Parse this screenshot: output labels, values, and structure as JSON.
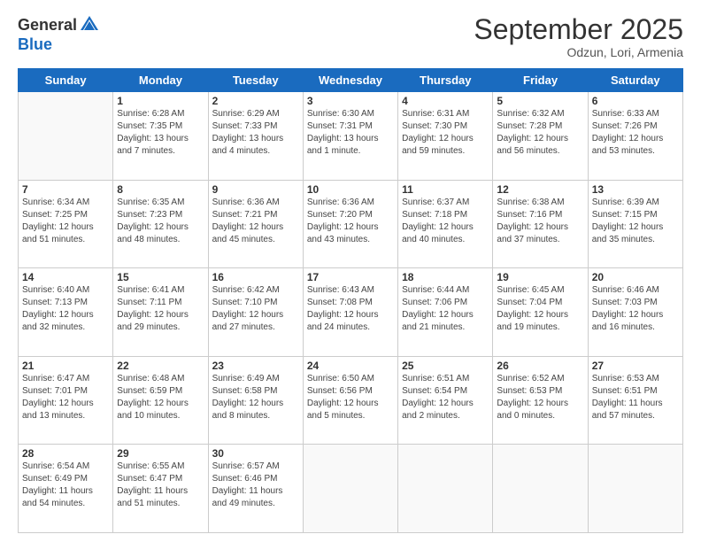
{
  "header": {
    "logo_general": "General",
    "logo_blue": "Blue",
    "month_title": "September 2025",
    "location": "Odzun, Lori, Armenia"
  },
  "weekdays": [
    "Sunday",
    "Monday",
    "Tuesday",
    "Wednesday",
    "Thursday",
    "Friday",
    "Saturday"
  ],
  "weeks": [
    [
      {
        "day": "",
        "sunrise": "",
        "sunset": "",
        "daylight": ""
      },
      {
        "day": "1",
        "sunrise": "Sunrise: 6:28 AM",
        "sunset": "Sunset: 7:35 PM",
        "daylight": "Daylight: 13 hours and 7 minutes."
      },
      {
        "day": "2",
        "sunrise": "Sunrise: 6:29 AM",
        "sunset": "Sunset: 7:33 PM",
        "daylight": "Daylight: 13 hours and 4 minutes."
      },
      {
        "day": "3",
        "sunrise": "Sunrise: 6:30 AM",
        "sunset": "Sunset: 7:31 PM",
        "daylight": "Daylight: 13 hours and 1 minute."
      },
      {
        "day": "4",
        "sunrise": "Sunrise: 6:31 AM",
        "sunset": "Sunset: 7:30 PM",
        "daylight": "Daylight: 12 hours and 59 minutes."
      },
      {
        "day": "5",
        "sunrise": "Sunrise: 6:32 AM",
        "sunset": "Sunset: 7:28 PM",
        "daylight": "Daylight: 12 hours and 56 minutes."
      },
      {
        "day": "6",
        "sunrise": "Sunrise: 6:33 AM",
        "sunset": "Sunset: 7:26 PM",
        "daylight": "Daylight: 12 hours and 53 minutes."
      }
    ],
    [
      {
        "day": "7",
        "sunrise": "Sunrise: 6:34 AM",
        "sunset": "Sunset: 7:25 PM",
        "daylight": "Daylight: 12 hours and 51 minutes."
      },
      {
        "day": "8",
        "sunrise": "Sunrise: 6:35 AM",
        "sunset": "Sunset: 7:23 PM",
        "daylight": "Daylight: 12 hours and 48 minutes."
      },
      {
        "day": "9",
        "sunrise": "Sunrise: 6:36 AM",
        "sunset": "Sunset: 7:21 PM",
        "daylight": "Daylight: 12 hours and 45 minutes."
      },
      {
        "day": "10",
        "sunrise": "Sunrise: 6:36 AM",
        "sunset": "Sunset: 7:20 PM",
        "daylight": "Daylight: 12 hours and 43 minutes."
      },
      {
        "day": "11",
        "sunrise": "Sunrise: 6:37 AM",
        "sunset": "Sunset: 7:18 PM",
        "daylight": "Daylight: 12 hours and 40 minutes."
      },
      {
        "day": "12",
        "sunrise": "Sunrise: 6:38 AM",
        "sunset": "Sunset: 7:16 PM",
        "daylight": "Daylight: 12 hours and 37 minutes."
      },
      {
        "day": "13",
        "sunrise": "Sunrise: 6:39 AM",
        "sunset": "Sunset: 7:15 PM",
        "daylight": "Daylight: 12 hours and 35 minutes."
      }
    ],
    [
      {
        "day": "14",
        "sunrise": "Sunrise: 6:40 AM",
        "sunset": "Sunset: 7:13 PM",
        "daylight": "Daylight: 12 hours and 32 minutes."
      },
      {
        "day": "15",
        "sunrise": "Sunrise: 6:41 AM",
        "sunset": "Sunset: 7:11 PM",
        "daylight": "Daylight: 12 hours and 29 minutes."
      },
      {
        "day": "16",
        "sunrise": "Sunrise: 6:42 AM",
        "sunset": "Sunset: 7:10 PM",
        "daylight": "Daylight: 12 hours and 27 minutes."
      },
      {
        "day": "17",
        "sunrise": "Sunrise: 6:43 AM",
        "sunset": "Sunset: 7:08 PM",
        "daylight": "Daylight: 12 hours and 24 minutes."
      },
      {
        "day": "18",
        "sunrise": "Sunrise: 6:44 AM",
        "sunset": "Sunset: 7:06 PM",
        "daylight": "Daylight: 12 hours and 21 minutes."
      },
      {
        "day": "19",
        "sunrise": "Sunrise: 6:45 AM",
        "sunset": "Sunset: 7:04 PM",
        "daylight": "Daylight: 12 hours and 19 minutes."
      },
      {
        "day": "20",
        "sunrise": "Sunrise: 6:46 AM",
        "sunset": "Sunset: 7:03 PM",
        "daylight": "Daylight: 12 hours and 16 minutes."
      }
    ],
    [
      {
        "day": "21",
        "sunrise": "Sunrise: 6:47 AM",
        "sunset": "Sunset: 7:01 PM",
        "daylight": "Daylight: 12 hours and 13 minutes."
      },
      {
        "day": "22",
        "sunrise": "Sunrise: 6:48 AM",
        "sunset": "Sunset: 6:59 PM",
        "daylight": "Daylight: 12 hours and 10 minutes."
      },
      {
        "day": "23",
        "sunrise": "Sunrise: 6:49 AM",
        "sunset": "Sunset: 6:58 PM",
        "daylight": "Daylight: 12 hours and 8 minutes."
      },
      {
        "day": "24",
        "sunrise": "Sunrise: 6:50 AM",
        "sunset": "Sunset: 6:56 PM",
        "daylight": "Daylight: 12 hours and 5 minutes."
      },
      {
        "day": "25",
        "sunrise": "Sunrise: 6:51 AM",
        "sunset": "Sunset: 6:54 PM",
        "daylight": "Daylight: 12 hours and 2 minutes."
      },
      {
        "day": "26",
        "sunrise": "Sunrise: 6:52 AM",
        "sunset": "Sunset: 6:53 PM",
        "daylight": "Daylight: 12 hours and 0 minutes."
      },
      {
        "day": "27",
        "sunrise": "Sunrise: 6:53 AM",
        "sunset": "Sunset: 6:51 PM",
        "daylight": "Daylight: 11 hours and 57 minutes."
      }
    ],
    [
      {
        "day": "28",
        "sunrise": "Sunrise: 6:54 AM",
        "sunset": "Sunset: 6:49 PM",
        "daylight": "Daylight: 11 hours and 54 minutes."
      },
      {
        "day": "29",
        "sunrise": "Sunrise: 6:55 AM",
        "sunset": "Sunset: 6:47 PM",
        "daylight": "Daylight: 11 hours and 51 minutes."
      },
      {
        "day": "30",
        "sunrise": "Sunrise: 6:57 AM",
        "sunset": "Sunset: 6:46 PM",
        "daylight": "Daylight: 11 hours and 49 minutes."
      },
      {
        "day": "",
        "sunrise": "",
        "sunset": "",
        "daylight": ""
      },
      {
        "day": "",
        "sunrise": "",
        "sunset": "",
        "daylight": ""
      },
      {
        "day": "",
        "sunrise": "",
        "sunset": "",
        "daylight": ""
      },
      {
        "day": "",
        "sunrise": "",
        "sunset": "",
        "daylight": ""
      }
    ]
  ]
}
